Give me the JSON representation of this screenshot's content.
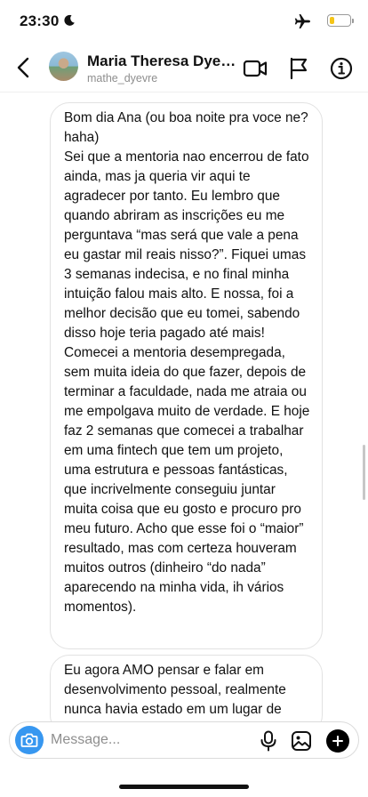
{
  "status_bar": {
    "time": "23:30",
    "battery_level": 0.25,
    "battery_color": "#f5c518",
    "icons": [
      "moon-icon",
      "airplane-icon",
      "battery-icon"
    ]
  },
  "header": {
    "contact_name": "Maria Theresa Dyevre",
    "contact_handle": "mathe_dyevre",
    "icons": [
      "back-icon",
      "video-call-icon",
      "flag-icon",
      "info-icon"
    ]
  },
  "messages": [
    {
      "paragraphs": [
        "Bom dia Ana (ou boa noite pra voce ne? haha)",
        "Sei que a mentoria nao encerrou de fato ainda, mas ja queria vir aqui te agradecer por tanto. Eu lembro que quando abriram as inscrições eu me perguntava “mas será que vale a pena eu gastar mil reais nisso?”. Fiquei umas 3 semanas indecisa,  e no final minha intuição falou mais alto. E nossa, foi a melhor decisão que eu tomei, sabendo disso hoje teria pagado até mais!",
        "Comecei a mentoria desempregada, sem muita ideia do que fazer, depois de terminar a faculdade, nada me atraia ou me empolgava muito de verdade. E hoje faz 2 semanas que comecei a trabalhar em uma fintech que tem um projeto, uma estrutura e pessoas fantásticas, que incrivelmente conseguiu juntar muita coisa que eu gosto e procuro pro meu futuro. Acho que esse foi o “maior” resultado, mas com certeza houveram muitos outros (dinheiro “do nada” aparecendo na minha vida, ih vários momentos)."
      ]
    },
    {
      "paragraphs": [
        "Eu agora AMO pensar e falar em desenvolvimento pessoal, realmente nunca havia estado em um lugar de"
      ]
    }
  ],
  "composer": {
    "placeholder": "Message...",
    "value": "",
    "accent_color": "#3797f0",
    "icons": [
      "camera-icon",
      "microphone-icon",
      "gallery-icon",
      "plus-icon"
    ]
  }
}
